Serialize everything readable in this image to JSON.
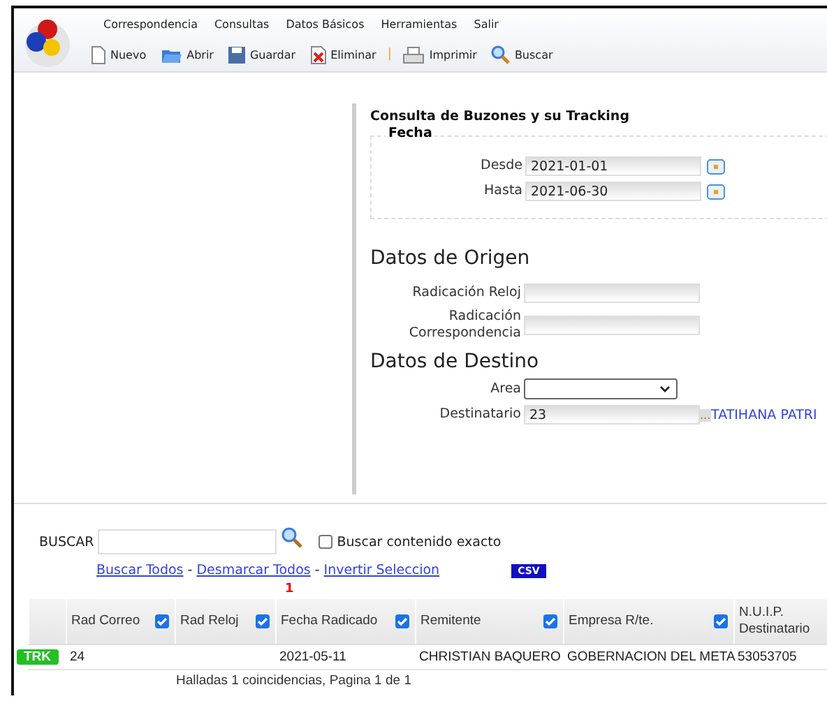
{
  "menu": [
    "Correspondencia",
    "Consultas",
    "Datos Básicos",
    "Herramientas",
    "Salir"
  ],
  "toolbar": [
    {
      "kind": "new",
      "label": "Nuevo"
    },
    {
      "kind": "open",
      "label": "Abrir"
    },
    {
      "kind": "save",
      "label": "Guardar"
    },
    {
      "kind": "delete",
      "label": "Eliminar"
    },
    {
      "kind": "separator",
      "label": "|"
    },
    {
      "kind": "print",
      "label": "Imprimir"
    },
    {
      "kind": "search",
      "label": "Buscar"
    }
  ],
  "form": {
    "title": "Consulta de Buzones y su Tracking",
    "fecha_legend": "Fecha",
    "desde_label": "Desde",
    "desde": "2021-01-01",
    "hasta_label": "Hasta",
    "hasta": "2021-06-30",
    "origen_title": "Datos de Origen",
    "reloj_label": "Radicación Reloj",
    "corr_label": "Radicación Correspondencia",
    "destino_title": "Datos de Destino",
    "area_label": "Area",
    "destinatario_label": "Destinatario",
    "destinatario": "23",
    "lookup": "...",
    "destinatario_name": "TATIHANA PATRI"
  },
  "search": {
    "label": "BUSCAR",
    "exact_label": "Buscar contenido exacto",
    "exact_checked": false,
    "links": [
      "Buscar Todos",
      "Desmarcar Todos",
      "Invertir Seleccion"
    ],
    "separator": "-",
    "csv": "CSV",
    "page": "1"
  },
  "table": {
    "columns": [
      {
        "label": "Rad Correo",
        "checked": true
      },
      {
        "label": "Rad Reloj",
        "checked": true
      },
      {
        "label": "Fecha Radicado",
        "checked": true
      },
      {
        "label": "Remitente",
        "checked": true
      },
      {
        "label": "Empresa R/te.",
        "checked": true
      },
      {
        "label": "N.U.I.P. Destinatario"
      }
    ],
    "rows": [
      {
        "tag": "TRK",
        "cells": [
          "24",
          "",
          "2021-05-11",
          "CHRISTIAN BAQUERO",
          "GOBERNACION DEL META",
          "53053705"
        ]
      }
    ]
  },
  "footer": "Halladas 1 coincidencias, Pagina 1 de 1"
}
